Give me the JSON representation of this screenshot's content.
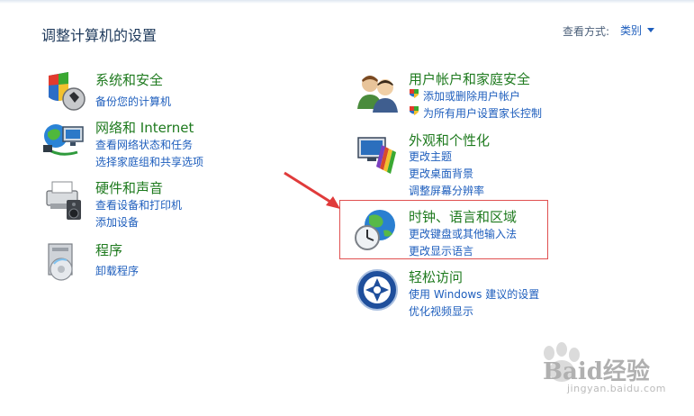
{
  "header": {
    "title": "调整计算机的设置",
    "view_by_label": "查看方式:",
    "view_by_value": "类别"
  },
  "categories_left": [
    {
      "title": "系统和安全",
      "links": [
        "备份您的计算机"
      ],
      "icon": "system-security-icon"
    },
    {
      "title": "网络和 Internet",
      "links": [
        "查看网络状态和任务",
        "选择家庭组和共享选项"
      ],
      "icon": "network-icon"
    },
    {
      "title": "硬件和声音",
      "links": [
        "查看设备和打印机",
        "添加设备"
      ],
      "icon": "hardware-sound-icon"
    },
    {
      "title": "程序",
      "links": [
        "卸载程序"
      ],
      "icon": "programs-icon"
    }
  ],
  "categories_right": [
    {
      "title": "用户帐户和家庭安全",
      "links": [
        "添加或删除用户帐户",
        "为所有用户设置家长控制"
      ],
      "icon": "user-accounts-icon"
    },
    {
      "title": "外观和个性化",
      "links": [
        "更改主题",
        "更改桌面背景",
        "调整屏幕分辨率"
      ],
      "icon": "appearance-icon"
    },
    {
      "title": "时钟、语言和区域",
      "links": [
        "更改键盘或其他输入法",
        "更改显示语言"
      ],
      "icon": "clock-globe-icon"
    },
    {
      "title": "轻松访问",
      "links": [
        "使用 Windows 建议的设置",
        "优化视频显示"
      ],
      "icon": "ease-of-access-icon"
    }
  ],
  "watermark": {
    "text": "Baid经验",
    "url_text": "jingyan.baidu.com"
  },
  "colors": {
    "title_green": "#1e7a1e",
    "link_blue": "#1e5ebd",
    "highlight_red": "#e05050"
  }
}
